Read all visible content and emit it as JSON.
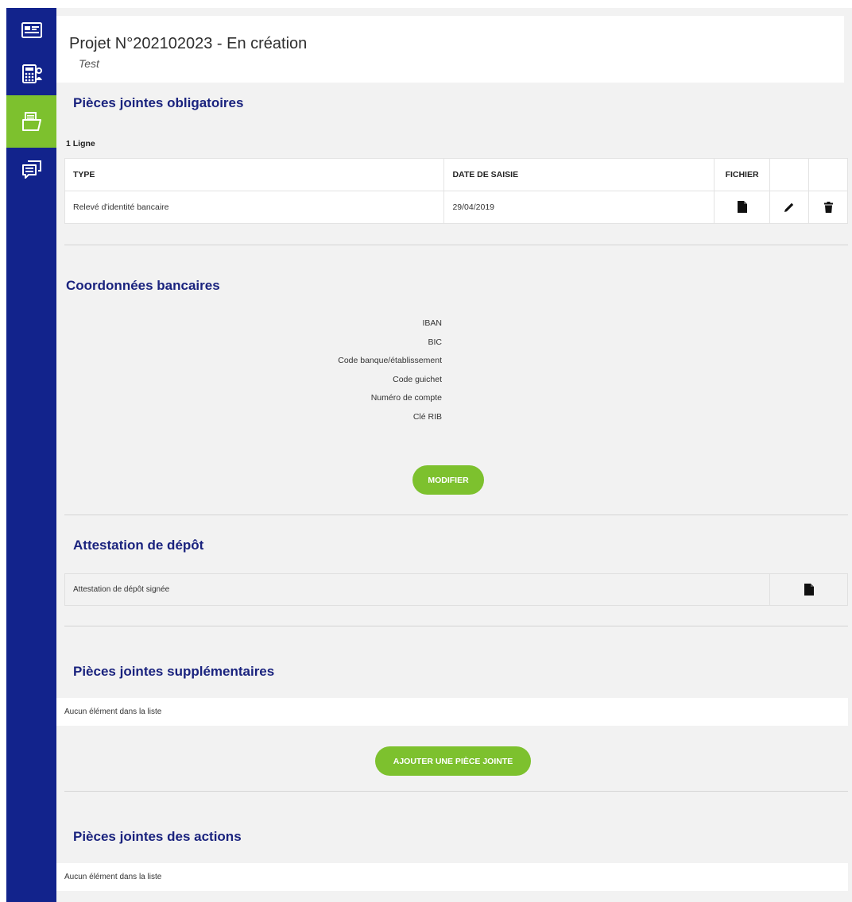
{
  "sidebar": {
    "items": [
      {
        "icon": "id-card-icon",
        "active": false
      },
      {
        "icon": "calculator-icon",
        "active": false
      },
      {
        "icon": "folder-document-icon",
        "active": true
      },
      {
        "icon": "chat-icon",
        "active": false
      }
    ]
  },
  "header": {
    "title": "Projet N°202102023 - En création",
    "subtitle": "Test"
  },
  "required_attachments": {
    "title": "Pièces jointes obligatoires",
    "count_label": "1 Ligne",
    "columns": [
      "TYPE",
      "DATE DE SAISIE",
      "FICHIER",
      "",
      ""
    ],
    "rows": [
      {
        "type": "Relevé d'identité bancaire",
        "date": "29/04/2019"
      }
    ]
  },
  "bank_details": {
    "title": "Coordonnées bancaires",
    "fields": [
      "IBAN",
      "BIC",
      "Code banque/établissement",
      "Code guichet",
      "Numéro de compte",
      "Clé RIB"
    ],
    "modify_label": "MODIFIER"
  },
  "deposit_certificate": {
    "title": "Attestation de dépôt",
    "row_label": "Attestation de dépôt signée"
  },
  "extra_attachments": {
    "title": "Pièces jointes supplémentaires",
    "empty_text": "Aucun élément dans la liste",
    "add_label": "AJOUTER UNE PIÈCE JOINTE"
  },
  "action_attachments": {
    "title": "Pièces jointes des actions",
    "empty_text": "Aucun élément dans la liste"
  },
  "colors": {
    "sidebar": "#12238c",
    "accent": "#7dc12e",
    "title": "#1a237e"
  }
}
